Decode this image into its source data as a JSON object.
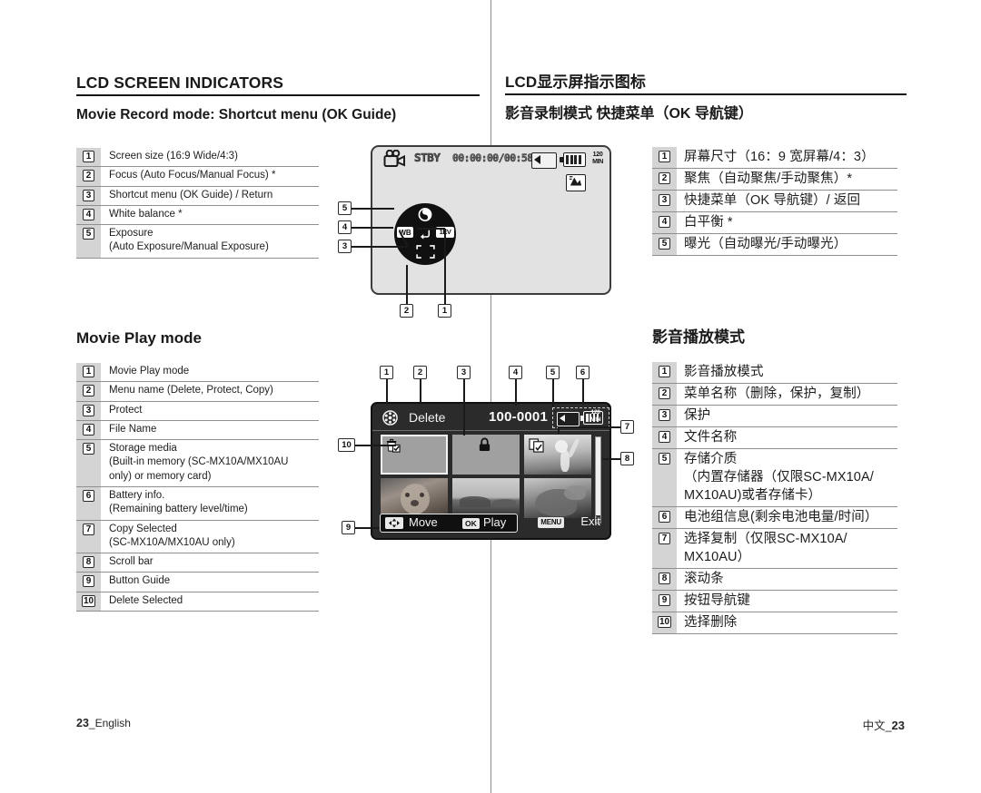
{
  "english": {
    "section_title": "LCD SCREEN INDICATORS",
    "subtitle_record": "Movie Record mode: Shortcut menu (OK Guide)",
    "subtitle_play": "Movie Play mode",
    "record_items": [
      {
        "num": "1",
        "text": "Screen size (16:9 Wide/4:3)"
      },
      {
        "num": "2",
        "text": "Focus (Auto Focus/Manual Focus) *"
      },
      {
        "num": "3",
        "text": "Shortcut menu (OK Guide) / Return"
      },
      {
        "num": "4",
        "text": "White balance *"
      },
      {
        "num": "5",
        "text": "Exposure\n(Auto Exposure/Manual Exposure)"
      }
    ],
    "play_items": [
      {
        "num": "1",
        "text": "Movie Play mode"
      },
      {
        "num": "2",
        "text": "Menu name (Delete, Protect, Copy)"
      },
      {
        "num": "3",
        "text": "Protect"
      },
      {
        "num": "4",
        "text": "File Name"
      },
      {
        "num": "5",
        "text": "Storage media\n(Built-in memory (SC-MX10A/MX10AU\nonly) or memory card)"
      },
      {
        "num": "6",
        "text": "Battery info.\n(Remaining battery level/time)"
      },
      {
        "num": "7",
        "text": "Copy Selected\n(SC-MX10A/MX10AU only)"
      },
      {
        "num": "8",
        "text": "Scroll bar"
      },
      {
        "num": "9",
        "text": "Button Guide"
      },
      {
        "num": "10",
        "text": "Delete Selected"
      }
    ]
  },
  "chinese": {
    "section_title": "LCD显示屏指示图标",
    "subtitle_record": "影音录制模式 快捷菜单（OK 导航键）",
    "subtitle_play": "影音播放模式",
    "record_items": [
      {
        "num": "1",
        "text": "屏幕尺寸（16：9 宽屏幕/4：3）"
      },
      {
        "num": "2",
        "text": "聚焦（自动聚焦/手动聚焦）*"
      },
      {
        "num": "3",
        "text": "快捷菜单（OK 导航键）/ 返回"
      },
      {
        "num": "4",
        "text": "白平衡 *"
      },
      {
        "num": "5",
        "text": "曝光（自动曝光/手动曝光）"
      }
    ],
    "play_items": [
      {
        "num": "1",
        "text": "影音播放模式"
      },
      {
        "num": "2",
        "text": "菜单名称（删除，保护，复制）"
      },
      {
        "num": "3",
        "text": "保护"
      },
      {
        "num": "4",
        "text": "文件名称"
      },
      {
        "num": "5",
        "text": "存储介质\n（内置存储器（仅限SC-MX10A/\nMX10AU)或者存储卡）"
      },
      {
        "num": "6",
        "text": "电池组信息(剩余电池电量/时间）"
      },
      {
        "num": "7",
        "text": "选择复制（仅限SC-MX10A/\nMX10AU）"
      },
      {
        "num": "8",
        "text": "滚动条"
      },
      {
        "num": "9",
        "text": "按钮导航键"
      },
      {
        "num": "10",
        "text": "选择删除"
      }
    ]
  },
  "lcd_record": {
    "status": "STBY",
    "timecode": "00:00:00/00:58:00",
    "battery_time": "120\nMIN",
    "wheel": {
      "left_label": "WB",
      "right_label": "1EV"
    },
    "callouts": [
      "1",
      "2",
      "3",
      "4",
      "5"
    ]
  },
  "lcd_play": {
    "menu_name": "Delete",
    "file_name": "100-0001",
    "battery_time": "120\nMIN",
    "button_guide": {
      "move_label": "Move",
      "ok_key": "OK",
      "play_label": "Play",
      "menu_key": "MENU",
      "exit_label": "Exit"
    },
    "callouts": [
      "1",
      "2",
      "3",
      "4",
      "5",
      "6",
      "7",
      "8",
      "9",
      "10"
    ]
  },
  "footer": {
    "left_num": "23",
    "left_text": "_English",
    "right_text": "中文_",
    "right_num": "23"
  }
}
